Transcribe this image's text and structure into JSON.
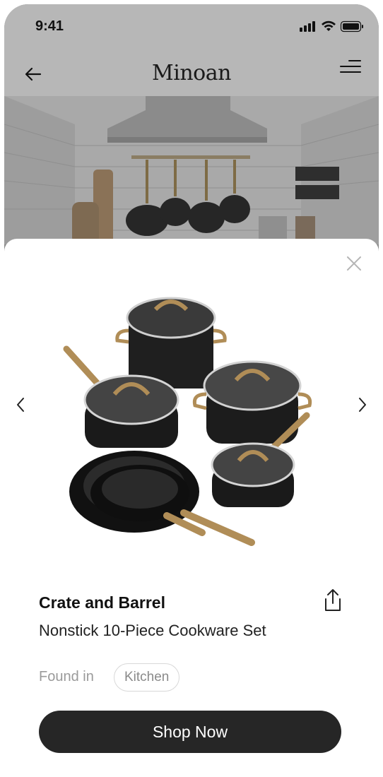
{
  "status_bar": {
    "time": "9:41",
    "icons": [
      "signal-icon",
      "wifi-icon",
      "battery-icon"
    ]
  },
  "header": {
    "brand": "Minoan",
    "back_icon": "arrow-left-icon",
    "menu_icon": "menu-icon"
  },
  "hero": {
    "description_icon": "kitchen-photo"
  },
  "sheet": {
    "close_icon": "close-icon",
    "prev_icon": "chevron-left-icon",
    "next_icon": "chevron-right-icon",
    "share_icon": "share-icon",
    "product": {
      "brand": "Crate and Barrel",
      "name": "Nonstick 10-Piece Cookware Set"
    },
    "found_in_label": "Found in",
    "room": "Kitchen",
    "cta_label": "Shop Now"
  },
  "colors": {
    "overlay": "#8c8c8c",
    "button": "#262626",
    "gold": "#b08d57",
    "pot": "#1f1f1f"
  }
}
